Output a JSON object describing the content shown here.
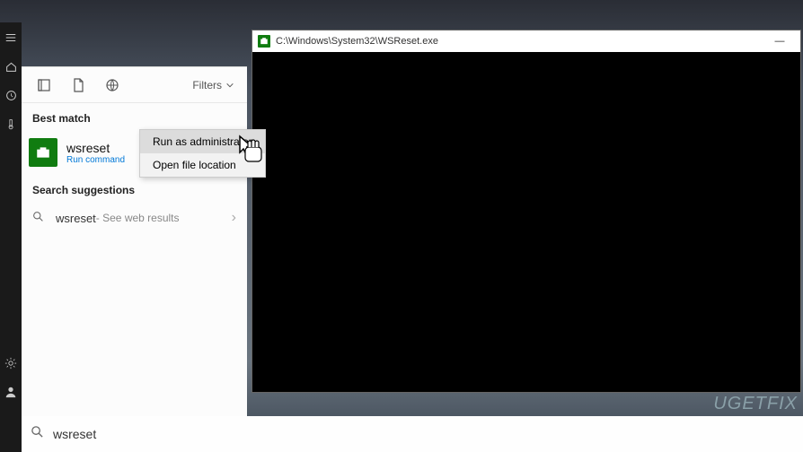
{
  "cmd": {
    "title": "C:\\Windows\\System32\\WSReset.exe"
  },
  "startMenu": {
    "filtersLabel": "Filters",
    "bestMatchLabel": "Best match",
    "result": {
      "title": "wsreset",
      "subtitle": "Run command"
    },
    "searchSuggestionsLabel": "Search suggestions",
    "suggestion": {
      "text": "wsreset",
      "sub": " - See web results"
    }
  },
  "contextMenu": {
    "runAsAdmin": "Run as administrator",
    "openFileLocation": "Open file location"
  },
  "taskbar": {
    "searchValue": "wsreset"
  },
  "watermark": "UGETFIX"
}
